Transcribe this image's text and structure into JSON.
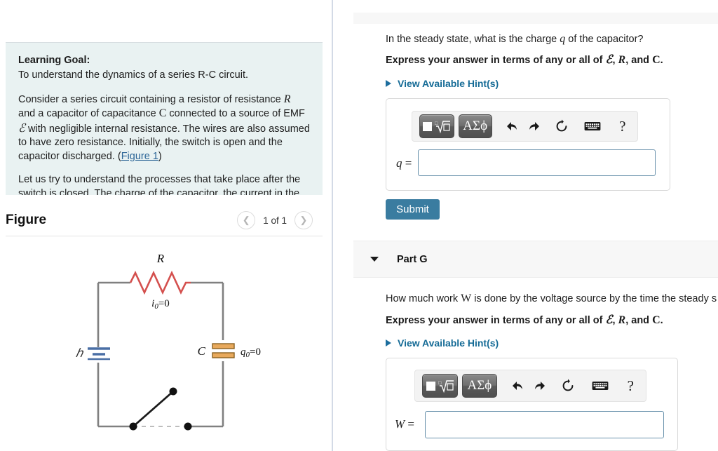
{
  "left": {
    "goal": {
      "title": "Learning Goal:",
      "subtitle": "To understand the dynamics of a series R-C circuit.",
      "para1_a": "Consider a series circuit containing a resistor of resistance ",
      "para1_R": "R",
      "para1_b": " and a capacitor of capacitance ",
      "para1_C": "C",
      "para1_c": " connected to a source of EMF ",
      "para1_E": "ℰ",
      "para1_d": " with negligible internal resistance. The wires are also assumed to have zero resistance. Initially, the switch is open and the capacitor discharged. (",
      "figure_link": "Figure 1",
      "para1_e": ")",
      "para2": "Let us try to understand the processes that take place after the switch is closed. The charge of the capacitor, the current in the circuit, and, correspondingly, the voltages across the resistor and"
    },
    "figure": {
      "title": "Figure",
      "prev_icon": "chevron-left-icon",
      "next_icon": "chevron-right-icon",
      "counter": "1 of 1",
      "circuit": {
        "resistor_label": "R",
        "current_label": "i₀=0",
        "emf_label": "ℰ",
        "capacitor_label": "C",
        "charge_label": "q₀=0",
        "resistor_color": "#d4504e",
        "capacitor_color": "#e8a champion",
        "wire_color": "#808080",
        "battery_color": "#4a6fa5"
      }
    }
  },
  "right": {
    "part_f": {
      "question_a": "In the steady state, what is the charge ",
      "question_q": "q",
      "question_b": " of the capacitor?",
      "instruction_a": "Express your answer in terms of any or all of ",
      "instruction_E": "ℰ",
      "instruction_comma1": ", ",
      "instruction_R": "R",
      "instruction_and": ", and ",
      "instruction_C": "C",
      "instruction_period": ".",
      "hint_label": "View Available Hint(s)",
      "hint_icon": "triangle-right-icon",
      "answer_label": "q",
      "answer_equals": "=",
      "answer_value": "",
      "submit_label": "Submit"
    },
    "part_g": {
      "header_label": "Part G",
      "caret_icon": "caret-down-icon",
      "question_a": "How much work ",
      "question_W": "W",
      "question_b": " is done by the voltage source by the time the steady s",
      "instruction_a": "Express your answer in terms of any or all of ",
      "instruction_E": "ℰ",
      "instruction_comma1": ", ",
      "instruction_R": "R",
      "instruction_and": ", and ",
      "instruction_C": "C",
      "instruction_period": ".",
      "hint_label": "View Available Hint(s)",
      "hint_icon": "triangle-right-icon",
      "answer_label": "W",
      "answer_equals": "=",
      "answer_value": ""
    },
    "toolbar": {
      "template_icon": "math-template-icon",
      "greek_label": "ΑΣϕ",
      "undo_icon": "undo-arrow-icon",
      "redo_icon": "redo-arrow-icon",
      "reset_icon": "reset-circular-arrow-icon",
      "keyboard_icon": "keyboard-icon",
      "help_label": "?"
    }
  },
  "colors": {
    "accent_blue": "#3a7ca0",
    "link_blue": "#156b96",
    "goal_bg": "#e9f2f2",
    "part_header_bg": "#f7f7f7",
    "input_border": "#6b93ad"
  }
}
